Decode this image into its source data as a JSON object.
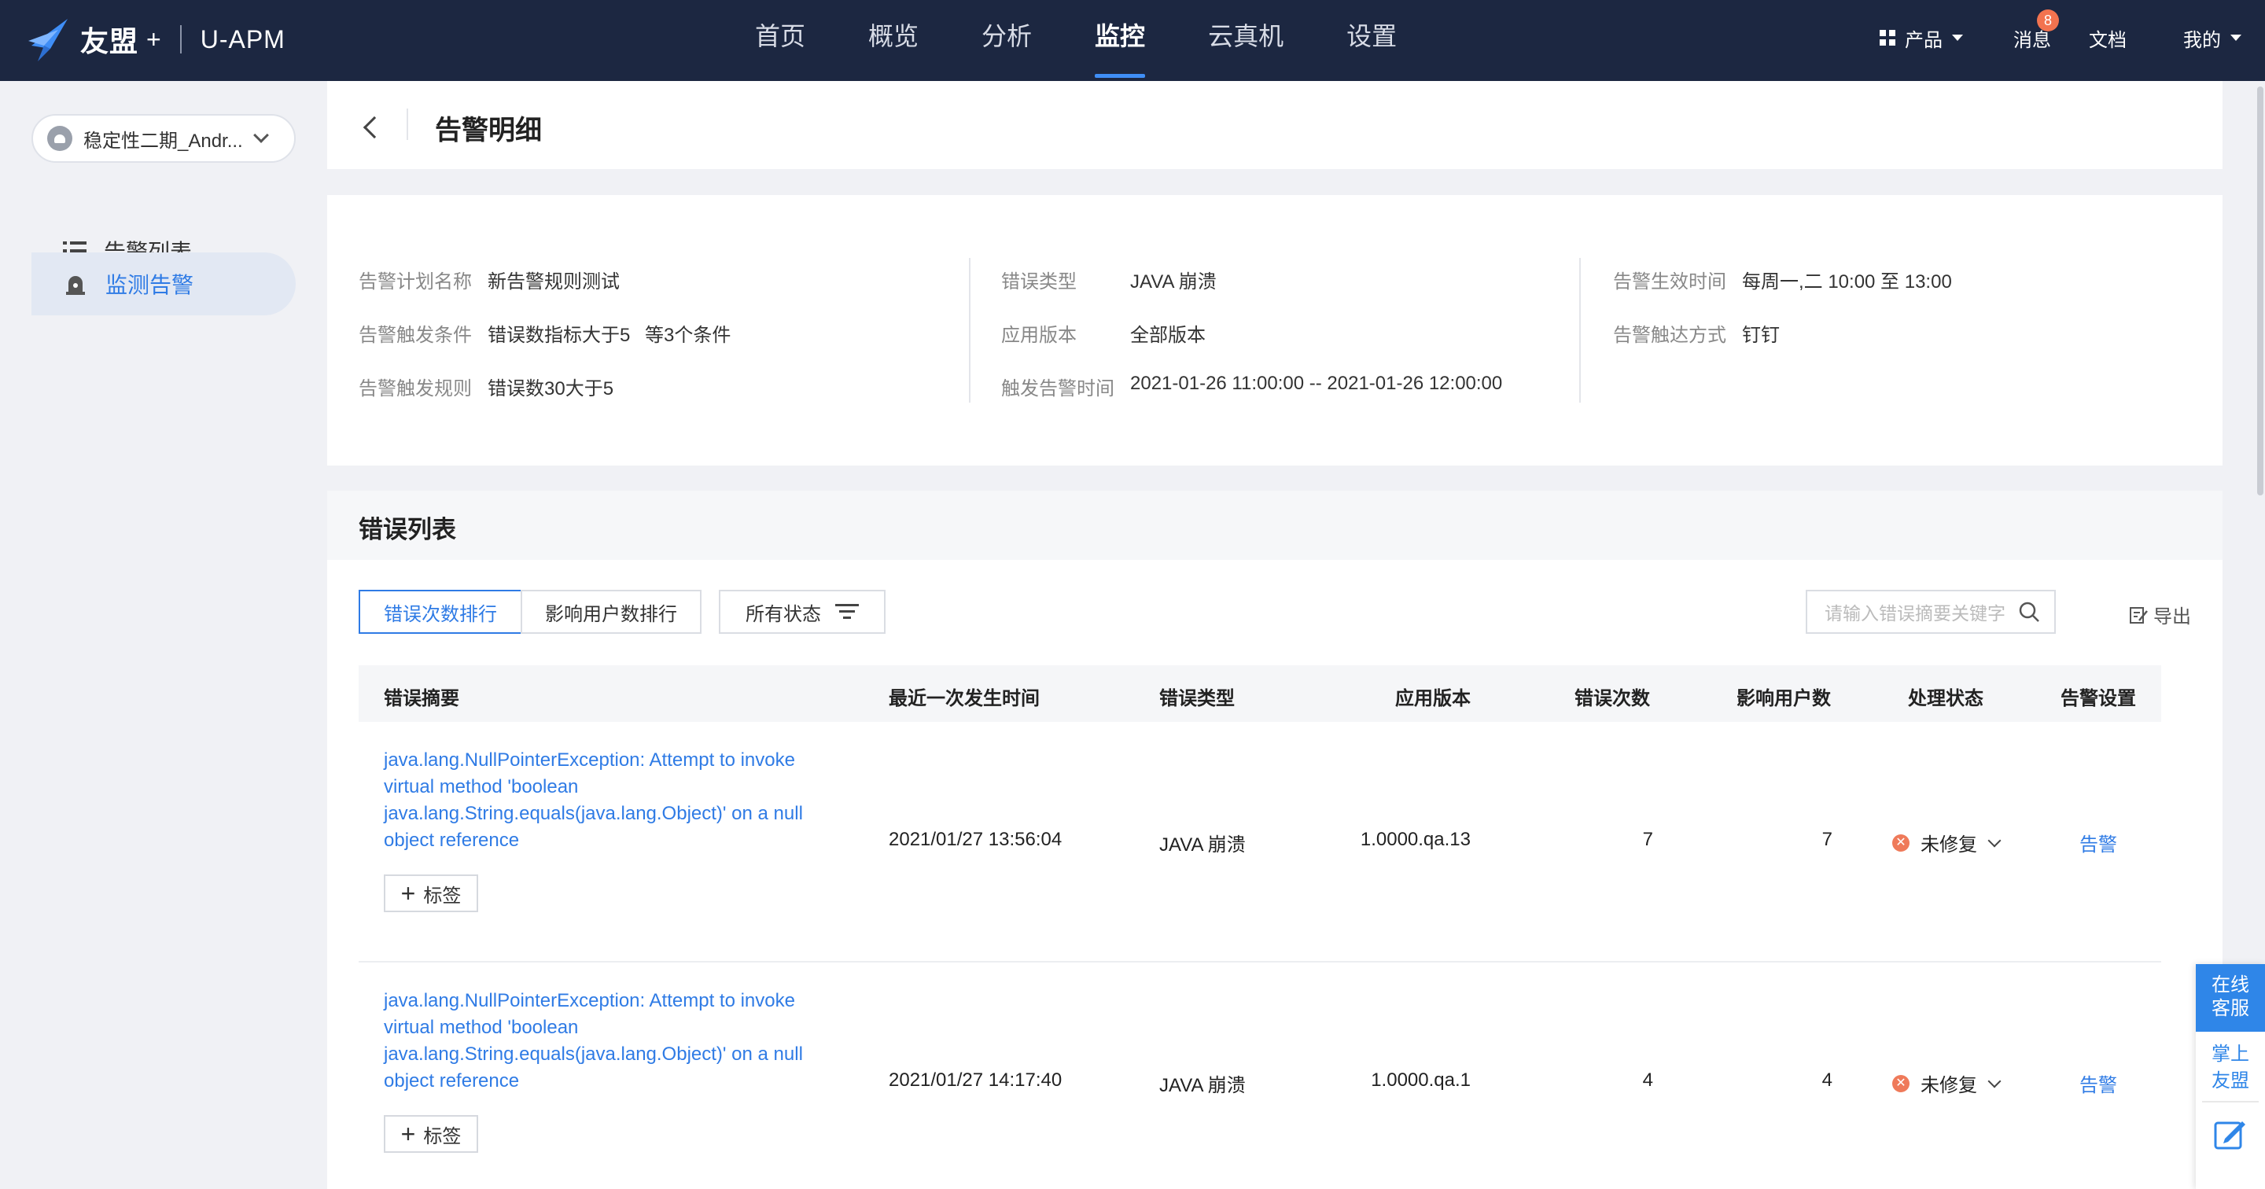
{
  "header": {
    "brand": "友盟",
    "plus": "+",
    "product": "U-APM",
    "nav": [
      "首页",
      "概览",
      "分析",
      "监控",
      "云真机",
      "设置"
    ],
    "active_nav": "监控",
    "right": {
      "products": "产品",
      "messages": "消息",
      "message_badge": "8",
      "docs": "文档",
      "mine": "我的"
    }
  },
  "sidebar": {
    "app_selector": "稳定性二期_Andr...",
    "items": [
      {
        "label": "告警列表",
        "icon": "list-icon"
      },
      {
        "label": "监测告警",
        "icon": "alarm-icon",
        "active": true
      }
    ]
  },
  "detail": {
    "title": "告警明细",
    "fields": {
      "plan_name_label": "告警计划名称",
      "plan_name": "新告警规则测试",
      "condition_label": "告警触发条件",
      "condition": "错误数指标大于5",
      "condition_extra": "等3个条件",
      "rule_label": "告警触发规则",
      "rule": "错误数30大于5",
      "error_type_label": "错误类型",
      "error_type": "JAVA 崩溃",
      "app_version_label": "应用版本",
      "app_version": "全部版本",
      "trigger_time_label": "触发告警时间",
      "trigger_time": "2021-01-26 11:00:00 -- 2021-01-26 12:00:00",
      "effective_time_label": "告警生效时间",
      "effective_time": "每周一,二 10:00 至 13:00",
      "delivery_label": "告警触达方式",
      "delivery": "钉钉"
    }
  },
  "errors": {
    "title": "错误列表",
    "tabs": [
      "错误次数排行",
      "影响用户数排行"
    ],
    "status_filter": "所有状态",
    "search_placeholder": "请输入错误摘要关键字",
    "export": "导出",
    "columns": [
      "错误摘要",
      "最近一次发生时间",
      "错误类型",
      "应用版本",
      "错误次数",
      "影响用户数",
      "处理状态",
      "告警设置"
    ],
    "rows": [
      {
        "summary": "java.lang.NullPointerException: Attempt to invoke virtual method 'boolean java.lang.String.equals(java.lang.Object)' on a null object reference",
        "last_time": "2021/01/27 13:56:04",
        "type": "JAVA 崩溃",
        "version": "1.0000.qa.13",
        "count": "7",
        "users": "7",
        "status": "未修复",
        "alarm": "告警",
        "tag": "标签"
      },
      {
        "summary": "java.lang.NullPointerException: Attempt to invoke virtual method 'boolean java.lang.String.equals(java.lang.Object)' on a null object reference",
        "last_time": "2021/01/27 14:17:40",
        "type": "JAVA 崩溃",
        "version": "1.0000.qa.1",
        "count": "4",
        "users": "4",
        "status": "未修复",
        "alarm": "告警",
        "tag": "标签"
      }
    ]
  },
  "float_service": {
    "online": "在线客服",
    "app": "掌上友盟"
  },
  "colors": {
    "nav_bg": "#1c2741",
    "accent": "#2f7be5",
    "status_unfixed": "#ef7a5a"
  }
}
